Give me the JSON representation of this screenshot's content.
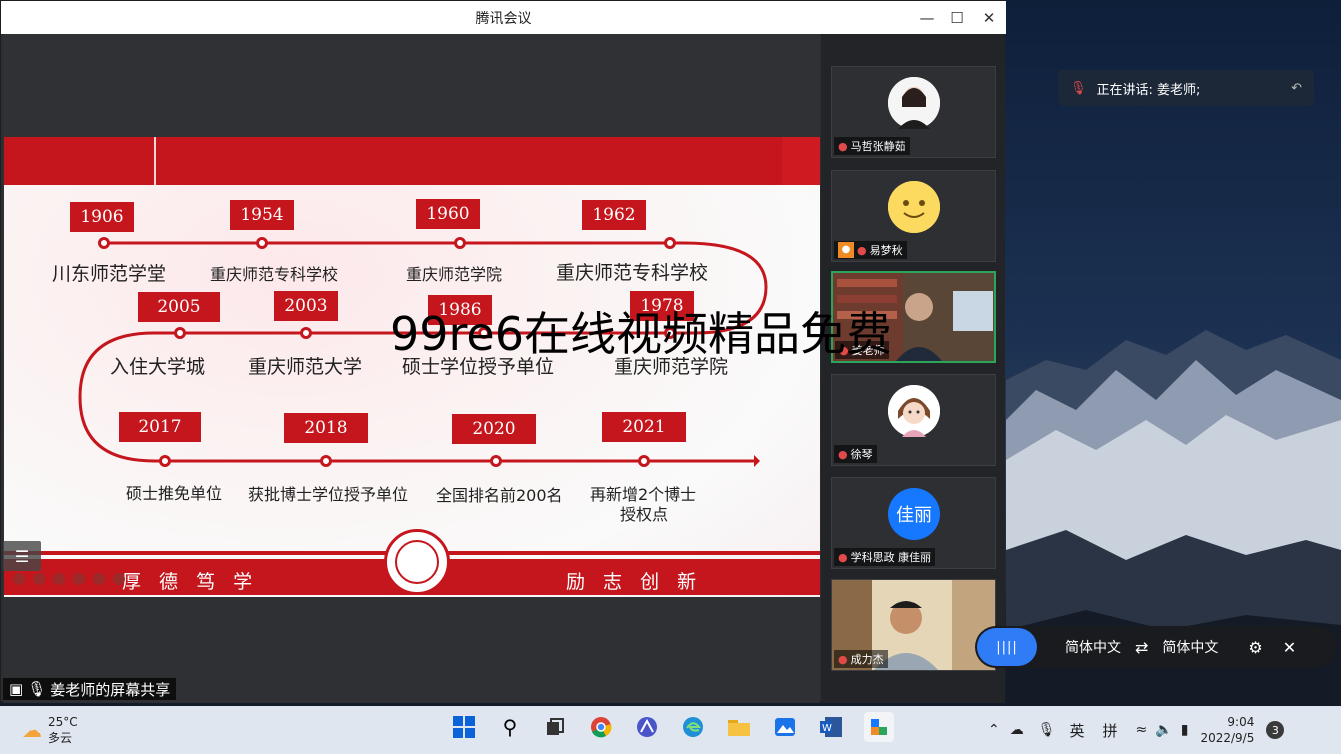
{
  "window": {
    "title": "腾讯会议",
    "min_icon": "minimize-icon",
    "max_icon": "maximize-icon",
    "close_icon": "close-icon"
  },
  "slide": {
    "milestones_row1": [
      {
        "year": "1906",
        "label": "川东师范学堂"
      },
      {
        "year": "1954",
        "label": "重庆师范专科学校"
      },
      {
        "year": "1960",
        "label": "重庆师范学院"
      },
      {
        "year": "1962",
        "label": "重庆师范专科学校"
      }
    ],
    "milestones_row2": [
      {
        "year": "2005",
        "label": "入住大学城"
      },
      {
        "year": "2003",
        "label": "重庆师范大学"
      },
      {
        "year": "1986",
        "label": "硕士学位授予单位"
      },
      {
        "year": "1978",
        "label": "重庆师范学院"
      }
    ],
    "milestones_row3": [
      {
        "year": "2017",
        "label": "硕士推免单位"
      },
      {
        "year": "2018",
        "label": "获批博士学位授予单位"
      },
      {
        "year": "2020",
        "label": "全国排名前200名"
      },
      {
        "year": "2021",
        "label": "再新增2个博士",
        "label2": "授权点"
      }
    ],
    "motto_left": "厚 德   笃 学",
    "motto_right": "励 志   创 新",
    "accent_color": "#c4161c"
  },
  "share_label": "姜老师的屏幕共享",
  "participants": [
    {
      "name": "马哲张静茹",
      "avatar": "photo-avatar-icon"
    },
    {
      "name": "易梦秋",
      "avatar": "smiley-avatar-icon"
    },
    {
      "name": "姜老师",
      "avatar": "video-feed"
    },
    {
      "name": "徐琴",
      "avatar": "cartoon-avatar-icon"
    },
    {
      "name": "学科思政 康佳丽",
      "avatar_text": "佳丽"
    },
    {
      "name": "成力杰",
      "avatar": "video-feed"
    }
  ],
  "speaking": {
    "text": "正在讲话: 姜老师;"
  },
  "captions": {
    "source_lang": "简体中文",
    "target_lang": "简体中文",
    "swap_icon": "swap-icon",
    "settings_icon": "gear-icon",
    "close_icon": "close-icon"
  },
  "watermark": "99re6在线视频精品免费",
  "taskbar": {
    "weather_temp": "25°C",
    "weather_desc": "多云",
    "ime_lang": "英",
    "ime_mode": "拼",
    "time": "9:04",
    "date": "2022/9/5",
    "notification_count": "3"
  }
}
